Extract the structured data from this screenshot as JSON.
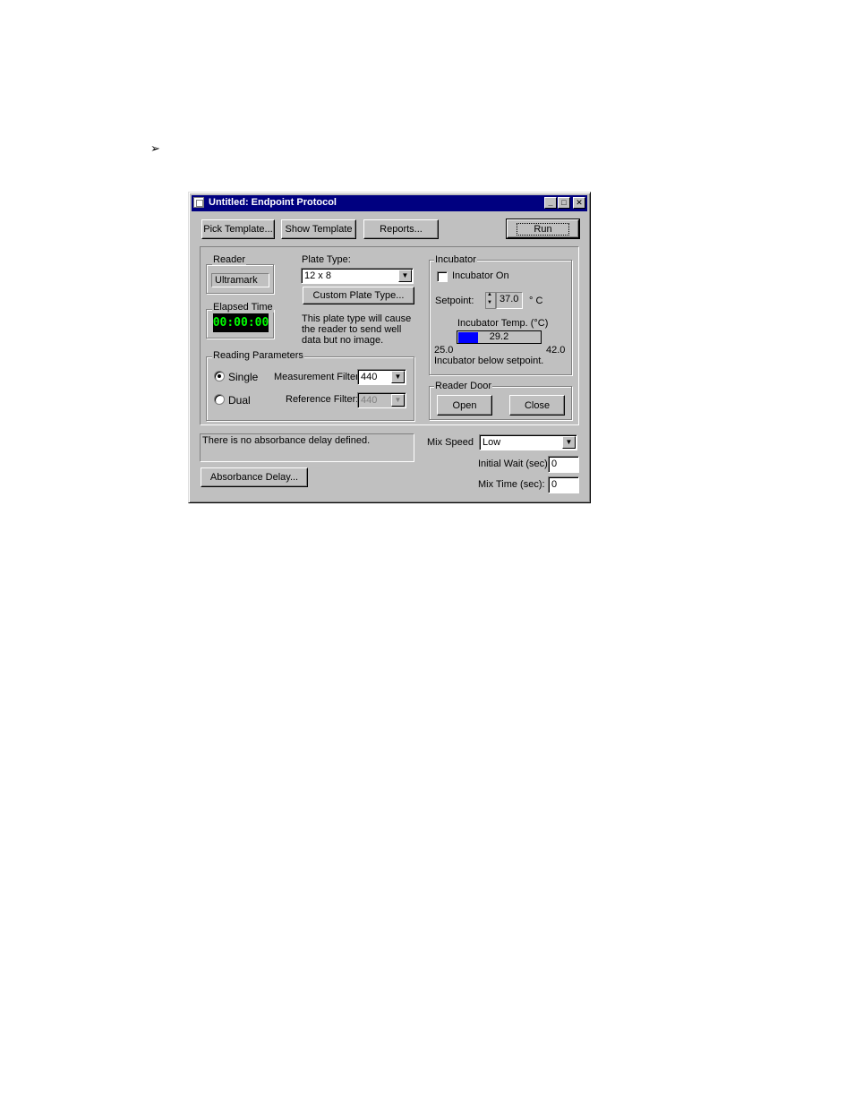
{
  "bullet": "➢",
  "window": {
    "title": "Untitled: Endpoint Protocol",
    "min_glyph": "_",
    "max_glyph": "□",
    "close_glyph": "✕"
  },
  "toolbar": {
    "pick_template": "Pick Template...",
    "show_template": "Show Template",
    "reports": "Reports...",
    "run": "Run"
  },
  "reader": {
    "group_label": "Reader",
    "value": "Ultramark"
  },
  "elapsed": {
    "group_label": "Elapsed Time",
    "value": "00:00:00"
  },
  "plate": {
    "label": "Plate Type:",
    "selected": "12 x 8",
    "custom_button": "Custom Plate Type...",
    "note": "This plate type will cause the reader to send well data but no image."
  },
  "reading": {
    "group_label": "Reading Parameters",
    "single_label": "Single",
    "dual_label": "Dual",
    "selected_mode": "single",
    "measurement_label": "Measurement Filter:",
    "measurement_value": "440",
    "reference_label": "Reference Filter:",
    "reference_value": "440"
  },
  "incubator": {
    "group_label": "Incubator",
    "on_label": "Incubator On",
    "on_checked": false,
    "setpoint_label": "Setpoint:",
    "setpoint_value": "37.0",
    "setpoint_unit": "° C",
    "temp_label": "Incubator Temp. (°C)",
    "temp_value": "29.2",
    "temp_numeric": 29.2,
    "min_label": "25.0",
    "max_label": "42.0",
    "min_numeric": 25.0,
    "max_numeric": 42.0,
    "status": "Incubator below setpoint.",
    "bar_color": "#0000ff"
  },
  "door": {
    "group_label": "Reader Door",
    "open": "Open",
    "close": "Close"
  },
  "absorbance": {
    "message": "There is no absorbance delay defined.",
    "button": "Absorbance Delay..."
  },
  "mix": {
    "speed_label": "Mix Speed",
    "speed_value": "Low",
    "initial_wait_label": "Initial Wait (sec):",
    "initial_wait_value": "0",
    "mix_time_label": "Mix Time (sec):",
    "mix_time_value": "0"
  }
}
